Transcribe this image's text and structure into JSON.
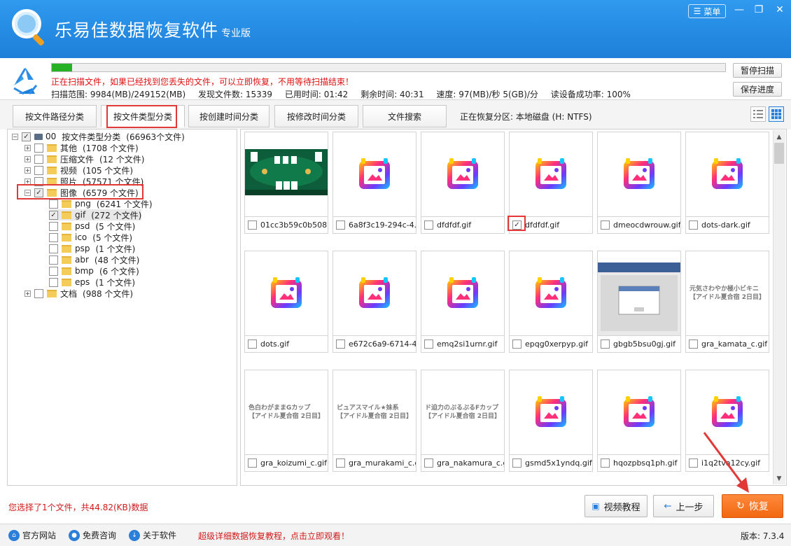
{
  "app": {
    "title": "乐易佳数据恢复软件",
    "edition": "专业版",
    "menu_label": "菜单"
  },
  "scan": {
    "progress": 0.03,
    "message": "正在扫描文件，如果已经找到您丢失的文件，可以立即恢复，不用等待扫描结束！",
    "range": "扫描范围: 9984(MB)/249152(MB)",
    "found": "发现文件数: 15339",
    "elapsed": "已用时间: 01:42",
    "remaining": "剩余时间: 40:31",
    "speed": "速度: 97(MB)/秒  5(GB)/分",
    "success_rate": "读设备成功率: 100%",
    "pause_label": "暂停扫描",
    "save_label": "保存进度"
  },
  "tabs": [
    "按文件路径分类",
    "按文件类型分类",
    "按创建时间分类",
    "按修改时间分类",
    "文件搜索"
  ],
  "partition": "正在恢复分区: 本地磁盘 (H: NTFS)",
  "tree": {
    "root": {
      "label": "按文件类型分类",
      "count": "(66963个文件)",
      "prefix": "00"
    },
    "items": [
      {
        "label": "其他",
        "count": "(1708 个文件)"
      },
      {
        "label": "压缩文件",
        "count": "(12 个文件)"
      },
      {
        "label": "视频",
        "count": "(105 个文件)"
      },
      {
        "label": "照片",
        "count": "(57571 个文件)"
      },
      {
        "label": "图像",
        "count": "(6579 个文件)"
      },
      {
        "label": "文档",
        "count": "(988 个文件)"
      }
    ],
    "image_children": [
      {
        "label": "png",
        "count": "(6241 个文件)"
      },
      {
        "label": "gif",
        "count": "(272 个文件)"
      },
      {
        "label": "psd",
        "count": "(5 个文件)"
      },
      {
        "label": "ico",
        "count": "(5 个文件)"
      },
      {
        "label": "psp",
        "count": "(1 个文件)"
      },
      {
        "label": "abr",
        "count": "(48 个文件)"
      },
      {
        "label": "bmp",
        "count": "(6 个文件)"
      },
      {
        "label": "eps",
        "count": "(1 个文件)"
      }
    ]
  },
  "files": [
    {
      "name": "01cc3b59c0b508...",
      "thumb": "game"
    },
    {
      "name": "6a8f3c19-294c-4...",
      "thumb": "icon"
    },
    {
      "name": "dfdfdf.gif",
      "thumb": "icon"
    },
    {
      "name": "dfdfdf.gif",
      "thumb": "icon",
      "checked": true
    },
    {
      "name": "dmeocdwrouw.gif",
      "thumb": "icon"
    },
    {
      "name": "dots-dark.gif",
      "thumb": "icon"
    },
    {
      "name": "dots.gif",
      "thumb": "icon"
    },
    {
      "name": "e672c6a9-6714-4...",
      "thumb": "icon"
    },
    {
      "name": "emq2si1urnr.gif",
      "thumb": "icon"
    },
    {
      "name": "epqg0xerpyp.gif",
      "thumb": "icon"
    },
    {
      "name": "gbgb5bsu0gj.gif",
      "thumb": "screen"
    },
    {
      "name": "gra_kamata_c.gif",
      "thumb": "text",
      "text1": "元気さわやか極小ビキニ",
      "text2": "【アイドル夏合宿 2日目】"
    },
    {
      "name": "gra_koizumi_c.gif",
      "thumb": "text",
      "text1": "色白わがままGカップ",
      "text2": "【アイドル夏合宿 2日目】"
    },
    {
      "name": "gra_murakami_c.gif",
      "thumb": "text",
      "text1": "ピュアスマイル★妹系",
      "text2": "【アイドル夏合宿 2日目】"
    },
    {
      "name": "gra_nakamura_c.gif",
      "thumb": "text",
      "text1": "ド迫力のぷるぷるFカップ",
      "text2": "【アイドル夏合宿 2日目】"
    },
    {
      "name": "gsmd5x1yndq.gif",
      "thumb": "icon"
    },
    {
      "name": "hqozpbsq1ph.gif",
      "thumb": "icon"
    },
    {
      "name": "i1q2tva12cy.gif",
      "thumb": "icon"
    }
  ],
  "selection_info": "您选择了1个文件，共44.82(KB)数据",
  "buttons": {
    "video": "视频教程",
    "prev": "上一步",
    "recover": "恢复"
  },
  "footer": {
    "site": "官方网站",
    "consult": "免费咨询",
    "about": "关于软件",
    "promo": "超级详细数据恢复教程，点击立即观看！",
    "version": "版本: 7.3.4"
  },
  "colors": {
    "header": "#2b8de8",
    "accent_red": "#e23838",
    "recover": "#f26710"
  }
}
